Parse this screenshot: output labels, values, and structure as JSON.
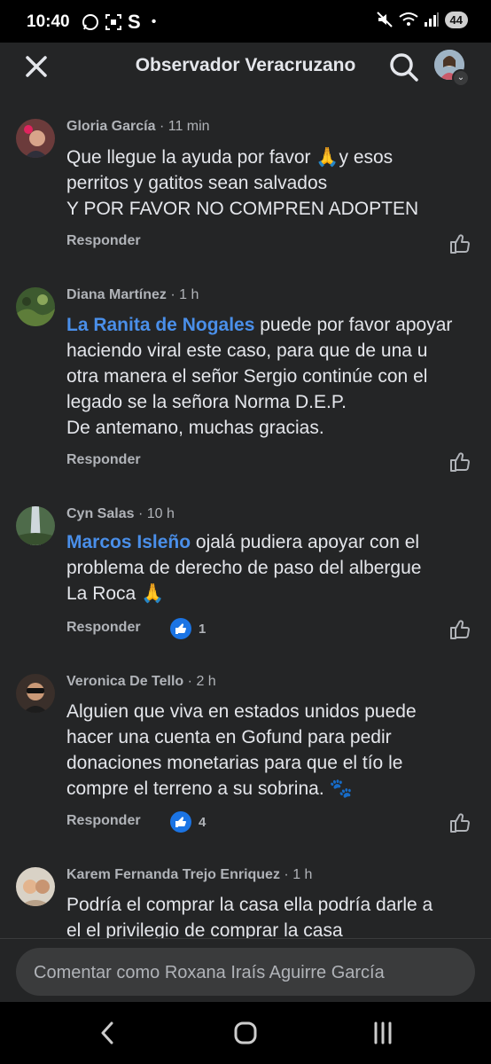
{
  "status_bar": {
    "time": "10:40",
    "app_letter": "S",
    "dot": "•",
    "battery": "44"
  },
  "header": {
    "title": "Observador Veracruzano"
  },
  "comments": [
    {
      "author": "Gloria García",
      "time": "11 min",
      "lines": [
        "Que llegue la ayuda por favor 🙏y esos",
        "perritos y gatitos sean salvados",
        "Y POR FAVOR NO COMPREN ADOPTEN"
      ],
      "reply_label": "Responder"
    },
    {
      "author": "Diana Martínez",
      "time": "1 h",
      "mention": "La Ranita de Nogales",
      "first_line_rest": " puede por favor apoyar",
      "lines": [
        "haciendo viral este caso, para que de una u",
        "otra manera el señor Sergio continúe con el",
        "legado se la señora Norma D.E.P.",
        "De antemano, muchas gracias."
      ],
      "reply_label": "Responder"
    },
    {
      "author": "Cyn Salas",
      "time": "10 h",
      "mention": "Marcos Isleño",
      "first_line_rest": " ojalá pudiera apoyar con el",
      "lines": [
        "problema de derecho de paso del albergue",
        "La Roca 🙏"
      ],
      "reply_label": "Responder",
      "reactions": "1"
    },
    {
      "author": "Veronica De Tello",
      "time": "2 h",
      "lines": [
        "Alguien que viva en estados unidos puede",
        "hacer una cuenta en Gofund para pedir",
        "donaciones monetarias para que el tío le",
        "compre el terreno a su sobrina. 🐾"
      ],
      "reply_label": "Responder",
      "reactions": "4"
    },
    {
      "author": "Karem Fernanda Trejo Enriquez",
      "time": "1 h",
      "lines": [
        "Podría el comprar la casa ella podría darle a",
        "el el privilegio de comprar la casa"
      ]
    }
  ],
  "composer": {
    "placeholder": "Comentar como Roxana Iraís Aguirre García"
  },
  "colors": {
    "background": "#242526",
    "mention": "#4a8fe9",
    "reaction_blue": "#1b74e4",
    "text": "#e4e6eb",
    "muted": "#b0b3b8"
  },
  "icons": [
    "close-icon",
    "search-icon",
    "like-icon",
    "reaction-like-icon",
    "back-icon",
    "home-icon",
    "recents-icon"
  ]
}
